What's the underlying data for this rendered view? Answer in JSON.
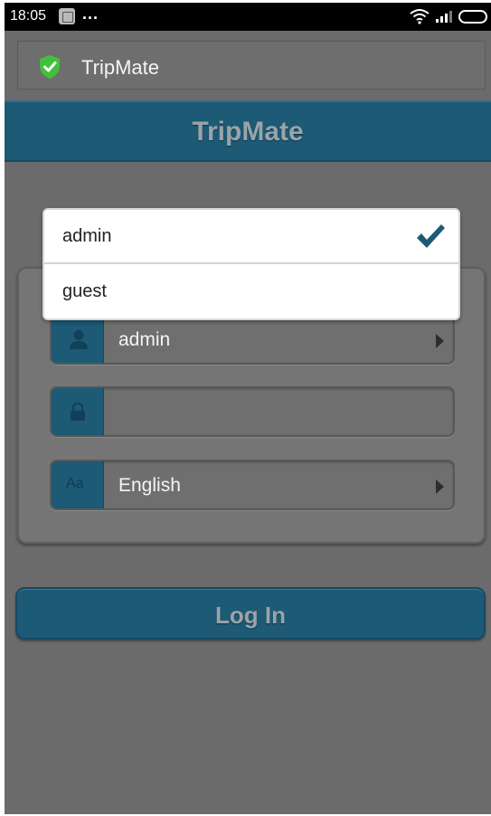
{
  "status_bar": {
    "time": "18:05",
    "more": "..."
  },
  "app_banner": {
    "title": "TripMate"
  },
  "title_bar": {
    "title": "TripMate"
  },
  "form": {
    "username": "admin",
    "password": "",
    "language": "English"
  },
  "login_button": {
    "label": "Log In"
  },
  "dropdown": {
    "options": [
      {
        "label": "admin",
        "selected": true
      },
      {
        "label": "guest",
        "selected": false
      }
    ]
  },
  "icons": {
    "font_icon": "Aa"
  },
  "colors": {
    "accent": "#1c5a76",
    "background": "#6b6b6b",
    "shield_green": "#43c03b",
    "checkmark": "#1c5a76"
  }
}
